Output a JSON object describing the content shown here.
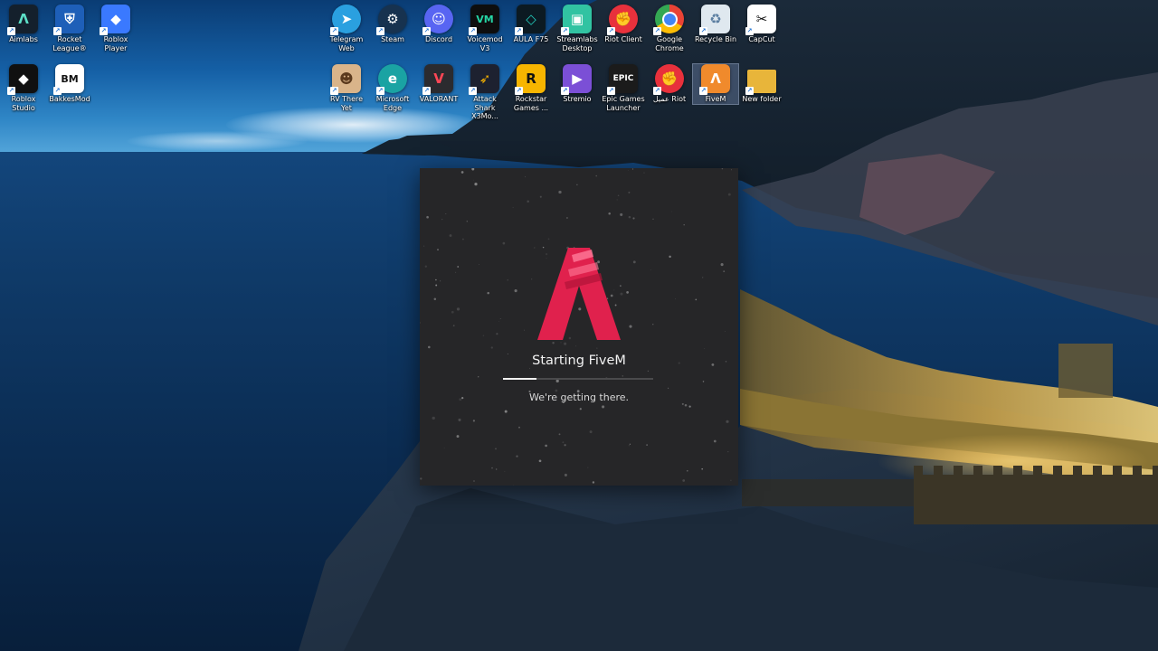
{
  "desktop": {
    "icons": [
      {
        "label": "Aimlabs",
        "icon": "aimlabs-icon",
        "bg": "#14202c",
        "fg": "#5de0c8",
        "glyph": "Λ"
      },
      {
        "label": "Rocket League®",
        "icon": "rocket-league-icon",
        "bg": "#1e5fb8",
        "fg": "#ffffff",
        "glyph": "⛨"
      },
      {
        "label": "Roblox Player",
        "icon": "roblox-player-icon",
        "bg": "#3a79ff",
        "fg": "#ffffff",
        "glyph": "◆"
      },
      {
        "label": "Roblox Studio",
        "icon": "roblox-studio-icon",
        "bg": "#101010",
        "fg": "#ffffff",
        "glyph": "◆"
      },
      {
        "label": "BakkesMod",
        "icon": "bakkesmod-icon",
        "bg": "#ffffff",
        "fg": "#111111",
        "glyph": "BM"
      },
      {
        "label": "Telegram Web",
        "icon": "telegram-icon",
        "bg": "#2aa0e0",
        "fg": "#ffffff",
        "glyph": "➤"
      },
      {
        "label": "Steam",
        "icon": "steam-icon",
        "bg": "#17324f",
        "fg": "#ffffff",
        "glyph": "⚙"
      },
      {
        "label": "Discord",
        "icon": "discord-icon",
        "bg": "#5865f2",
        "fg": "#ffffff",
        "glyph": "☺"
      },
      {
        "label": "Voicemod V3",
        "icon": "voicemod-icon",
        "bg": "#0e0e0e",
        "fg": "#25d5a5",
        "glyph": "VM"
      },
      {
        "label": "AULA F75",
        "icon": "aula-icon",
        "bg": "#0c1a22",
        "fg": "#22c7b8",
        "glyph": "◇"
      },
      {
        "label": "Streamlabs Desktop",
        "icon": "streamlabs-icon",
        "bg": "#31c3a2",
        "fg": "#ffffff",
        "glyph": "▣"
      },
      {
        "label": "Riot Client",
        "icon": "riot-client-icon",
        "bg": "#e8313c",
        "fg": "#ffffff",
        "glyph": "✊"
      },
      {
        "label": "Google Chrome",
        "icon": "chrome-icon",
        "bg": "#ffffff",
        "fg": "#ffffff",
        "glyph": ""
      },
      {
        "label": "Recycle Bin",
        "icon": "recycle-bin-icon",
        "bg": "#dfe8ef",
        "fg": "#5a7da0",
        "glyph": "♻"
      },
      {
        "label": "CapCut",
        "icon": "capcut-icon",
        "bg": "#ffffff",
        "fg": "#111111",
        "glyph": "✂"
      },
      {
        "label": "RV There Yet",
        "icon": "rv-there-yet-icon",
        "bg": "#d9b48a",
        "fg": "#5b3a1e",
        "glyph": "☻"
      },
      {
        "label": "Microsoft Edge",
        "icon": "edge-icon",
        "bg": "#1aa3a3",
        "fg": "#ffffff",
        "glyph": "e"
      },
      {
        "label": "VALORANT",
        "icon": "valorant-icon",
        "bg": "#2b2b2f",
        "fg": "#ff4655",
        "glyph": "V"
      },
      {
        "label": "Attack Shark X3Mo...",
        "icon": "attack-shark-icon",
        "bg": "#1d2130",
        "fg": "#f5b100",
        "glyph": "➶"
      },
      {
        "label": "Rockstar Games ...",
        "icon": "rockstar-icon",
        "bg": "#f7b500",
        "fg": "#111111",
        "glyph": "R"
      },
      {
        "label": "Stremio",
        "icon": "stremio-icon",
        "bg": "#7b4fd6",
        "fg": "#ffffff",
        "glyph": "▶"
      },
      {
        "label": "Epic Games Launcher",
        "icon": "epic-games-icon",
        "bg": "#1b1b1b",
        "fg": "#ffffff",
        "glyph": "EPIC"
      },
      {
        "label": "عميل Riot",
        "icon": "riot-client-icon",
        "bg": "#e8313c",
        "fg": "#ffffff",
        "glyph": "✊"
      },
      {
        "label": "FiveM",
        "icon": "fivem-icon",
        "bg": "#f08a2c",
        "fg": "#ffffff",
        "glyph": "Λ"
      },
      {
        "label": "New folder",
        "icon": "folder-icon",
        "bg": "#e8b53a",
        "fg": "#ffffff",
        "glyph": ""
      }
    ]
  },
  "splash": {
    "title": "Starting FiveM",
    "subtitle": "We're getting there.",
    "progress": 0.22,
    "accent": "#e0214d"
  }
}
